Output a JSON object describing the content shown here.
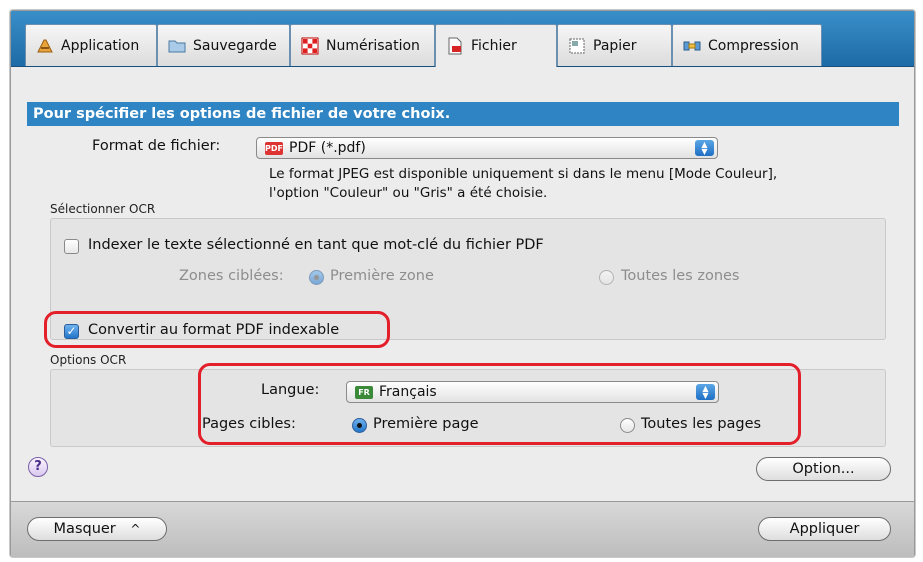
{
  "tabs": [
    {
      "label": "Application",
      "icon": "application-icon"
    },
    {
      "label": "Sauvegarde",
      "icon": "folder-icon"
    },
    {
      "label": "Numérisation",
      "icon": "scan-icon"
    },
    {
      "label": "Fichier",
      "icon": "file-icon",
      "active": true
    },
    {
      "label": "Papier",
      "icon": "paper-icon"
    },
    {
      "label": "Compression",
      "icon": "compression-icon"
    }
  ],
  "banner": "Pour spécifier les options de fichier de votre choix.",
  "file_format": {
    "label": "Format de fichier:",
    "value": "PDF (*.pdf)",
    "badge": "PDF",
    "note_line1": "Le format JPEG est disponible uniquement si dans le menu [Mode Couleur],",
    "note_line2": "l'option \"Couleur\" ou \"Gris\" a été choisie."
  },
  "ocr_select": {
    "group_label": "Sélectionner OCR",
    "index_checkbox_label": "Indexer le texte sélectionné en tant que mot-clé du fichier PDF",
    "index_checked": false,
    "zones_label": "Zones ciblées:",
    "zone_first": "Première zone",
    "zone_all": "Toutes les zones",
    "convert_checkbox_label": "Convertir au format PDF indexable",
    "convert_checked": true
  },
  "ocr_options": {
    "group_label": "Options OCR",
    "language_label": "Langue:",
    "language_value": "Français",
    "language_badge": "FR",
    "pages_label": "Pages cibles:",
    "page_first": "Première page",
    "page_all": "Toutes les pages",
    "selected": "first"
  },
  "buttons": {
    "help": "?",
    "option": "Option...",
    "hide": "Masquer",
    "hide_chevron": "^",
    "apply": "Appliquer"
  },
  "colors": {
    "tabbar": "#2a7bbd",
    "banner": "#2f84c3",
    "highlight": "#e3202a"
  }
}
